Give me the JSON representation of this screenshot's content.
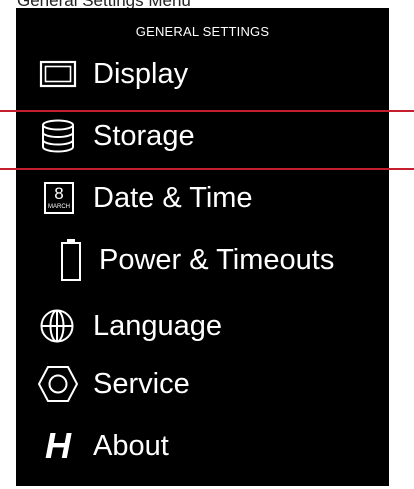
{
  "caption": "General Settings Menu",
  "menu": {
    "title": "GENERAL SETTINGS",
    "selected_index": 1,
    "accent_color": "#c41e2f",
    "items": [
      {
        "label": "Display",
        "icon": "display-icon"
      },
      {
        "label": "Storage",
        "icon": "storage-icon"
      },
      {
        "label": "Date & Time",
        "icon": "calendar-icon",
        "icon_day": "8",
        "icon_month": "MARCH"
      },
      {
        "label": "Power & Timeouts",
        "icon": "battery-icon"
      },
      {
        "label": "Language",
        "icon": "globe-icon"
      },
      {
        "label": "Service",
        "icon": "hex-nut-icon"
      },
      {
        "label": "About",
        "icon": "hasselblad-h-icon",
        "icon_text": "H"
      }
    ]
  }
}
